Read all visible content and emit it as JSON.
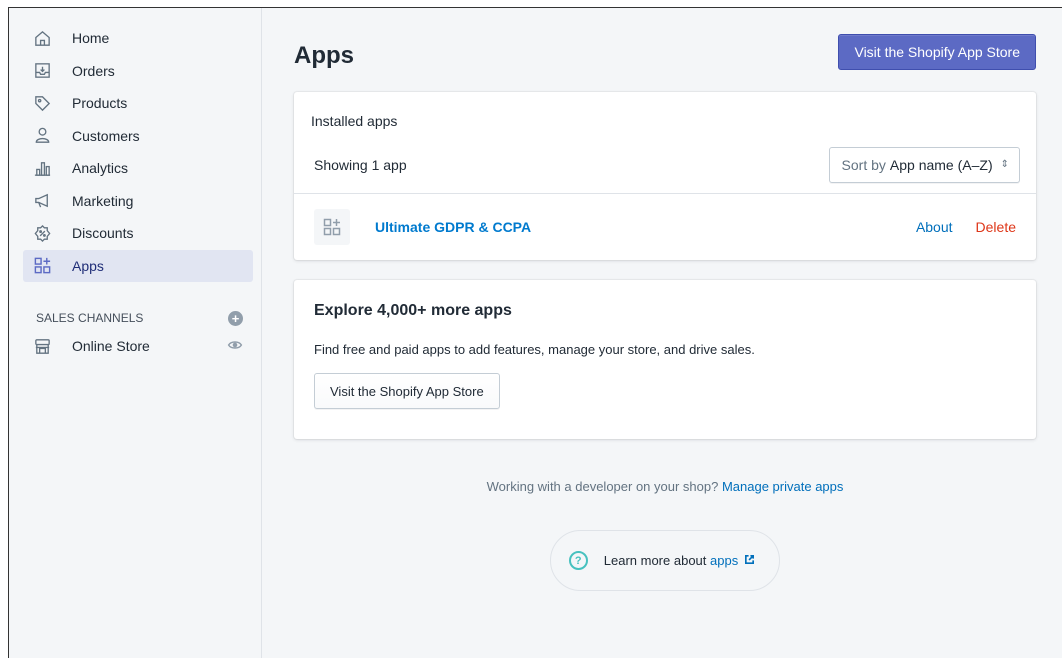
{
  "sidebar": {
    "items": [
      {
        "label": "Home",
        "icon": "home-icon"
      },
      {
        "label": "Orders",
        "icon": "orders-icon"
      },
      {
        "label": "Products",
        "icon": "tag-icon"
      },
      {
        "label": "Customers",
        "icon": "person-icon"
      },
      {
        "label": "Analytics",
        "icon": "bar-chart-icon"
      },
      {
        "label": "Marketing",
        "icon": "megaphone-icon"
      },
      {
        "label": "Discounts",
        "icon": "discount-icon"
      },
      {
        "label": "Apps",
        "icon": "apps-icon",
        "active": true
      }
    ],
    "sales_channels": {
      "header": "SALES CHANNELS",
      "add_icon": "plus-circle-icon",
      "online_store": {
        "label": "Online Store",
        "icon": "store-icon",
        "view_icon": "eye-icon"
      }
    }
  },
  "header": {
    "title": "Apps",
    "primary_button": "Visit the Shopify App Store"
  },
  "installed": {
    "title": "Installed apps",
    "count_text": "Showing 1 app",
    "sort_prefix": "Sort by",
    "sort_value": "App name (A–Z)",
    "apps": [
      {
        "name": "Ultimate GDPR & CCPA",
        "about": "About",
        "delete": "Delete"
      }
    ]
  },
  "explore": {
    "heading": "Explore 4,000+ more apps",
    "description": "Find free and paid apps to add features, manage your store, and drive sales.",
    "button": "Visit the Shopify App Store"
  },
  "footer": {
    "private_text": "Working with a developer on your shop?",
    "private_link": "Manage private apps",
    "learn_text": "Learn more about",
    "learn_link": "apps"
  },
  "colors": {
    "accent": "#5c6ac4",
    "link": "#006fbb",
    "danger": "#de3618",
    "help": "#47c1bf"
  }
}
